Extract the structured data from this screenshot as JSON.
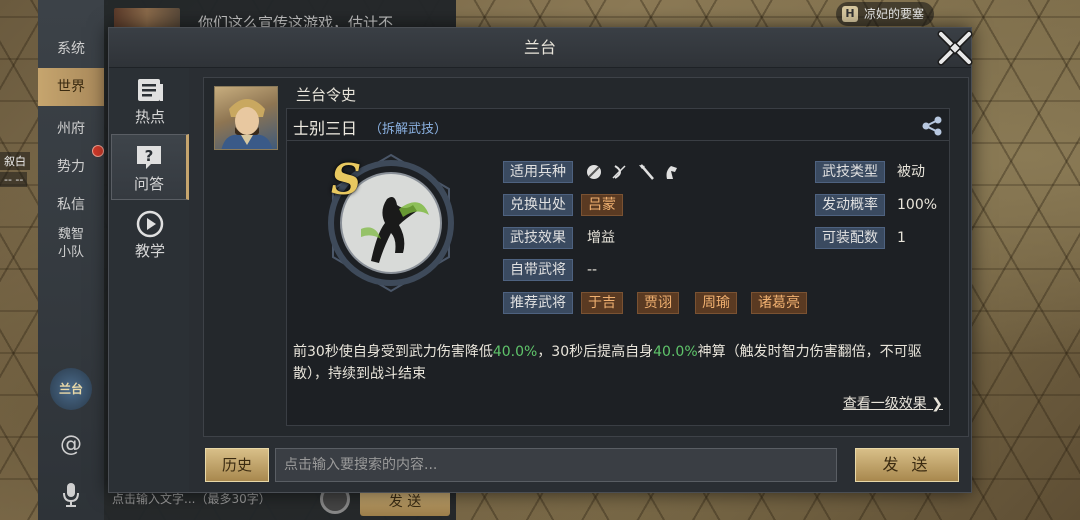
{
  "map": {
    "location_label": "凉妃的要塞",
    "left_tag_1": "叙白",
    "left_tag_2": "-- --"
  },
  "chat_bg": {
    "top_message": "你们这么宣传这游戏，估计不",
    "bottom_placeholder": "点击输入文字...（最多30字）",
    "bottom_send": "发 送"
  },
  "side_tabs": [
    {
      "label": "系统"
    },
    {
      "label": "世界",
      "active": true
    },
    {
      "label": "州府"
    },
    {
      "label": "势力"
    },
    {
      "label": "私信"
    },
    {
      "label": "魏智\n小队"
    }
  ],
  "side_icons": {
    "lantai_text": "兰台"
  },
  "modal": {
    "title": "兰台",
    "nav": [
      {
        "label": "热点",
        "icon": "news-icon"
      },
      {
        "label": "问答",
        "icon": "question-icon",
        "active": true
      },
      {
        "label": "教学",
        "icon": "play-icon"
      }
    ],
    "sender": "兰台令史",
    "skill": {
      "name": "士别三日",
      "subtitle": "（拆解武技）",
      "grade": "S",
      "labels": {
        "troop": "适用兵种",
        "source": "兑换出处",
        "effect": "武技效果",
        "own_general": "自带武将",
        "recommend": "推荐武将",
        "type": "武技类型",
        "rate": "发动概率",
        "slots": "可装配数"
      },
      "values": {
        "source": "吕蒙",
        "effect": "增益",
        "own_general": "--",
        "type": "被动",
        "rate": "100%",
        "slots": "1"
      },
      "recommend_generals": [
        "于吉",
        "贾诩",
        "周瑜",
        "诸葛亮"
      ],
      "description": {
        "p1": "前30秒使自身受到武力伤害降低",
        "hl1": "40.0%",
        "p2": "，30秒后提高自身",
        "hl2": "40.0%",
        "p3": "神算（触发时智力伤害翻倍，不可驱散），持续到战斗结束"
      },
      "more_link": "查看一级效果"
    },
    "bottom": {
      "history": "历史",
      "search_placeholder": "点击输入要搜索的内容...",
      "send": "发 送"
    }
  },
  "colors": {
    "highlight_green": "#5fc46a",
    "gold_button": "#d8bf88",
    "link_blue": "#8ab0e0"
  }
}
